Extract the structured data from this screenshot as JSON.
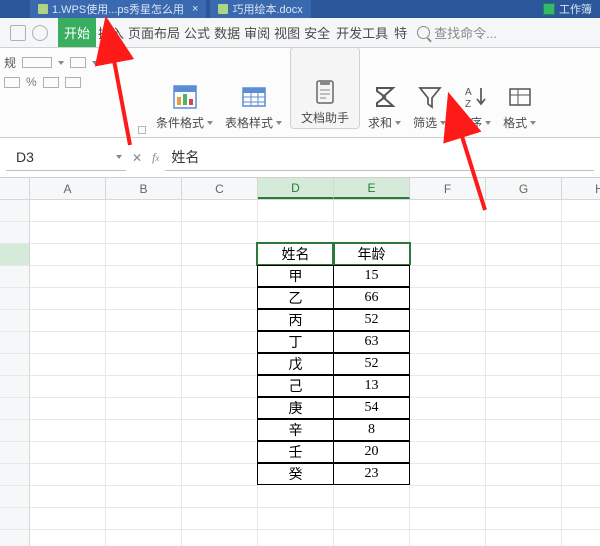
{
  "window": {
    "tab1_title": "1.WPS使用...ps秀星怎么用",
    "tab2_title": "巧用绘本.docx",
    "tab3_fragment": "工作簿"
  },
  "menu": {
    "start": "开始",
    "insert": "插入",
    "page_layout": "页面布局",
    "formulas": "公式",
    "data": "数据",
    "review": "审阅",
    "view": "视图",
    "security": "安全",
    "developer": "开发工具",
    "special": "特",
    "search_placeholder": "查找命令..."
  },
  "left_group_label": "规",
  "ribbon": {
    "cond_format": "条件格式",
    "table_style": "表格样式",
    "doc_helper": "文档助手",
    "sum": "求和",
    "filter": "筛选",
    "sort": "排序",
    "format": "格式"
  },
  "namebox": {
    "value": "D3"
  },
  "formula": {
    "value": "姓名"
  },
  "columns": [
    "A",
    "B",
    "C",
    "D",
    "E",
    "F",
    "G",
    "H"
  ],
  "selected_columns": [
    "D",
    "E"
  ],
  "table": {
    "header": {
      "name": "姓名",
      "age": "年龄"
    },
    "rows": [
      {
        "name": "甲",
        "age": 15
      },
      {
        "name": "乙",
        "age": 66
      },
      {
        "name": "丙",
        "age": 52
      },
      {
        "name": "丁",
        "age": 63
      },
      {
        "name": "戊",
        "age": 52
      },
      {
        "name": "己",
        "age": 13
      },
      {
        "name": "庚",
        "age": 54
      },
      {
        "name": "辛",
        "age": 8
      },
      {
        "name": "壬",
        "age": 20
      },
      {
        "name": "癸",
        "age": 23
      }
    ]
  },
  "annotations": [
    "arrow-to-start-tab",
    "arrow-to-filter-button"
  ]
}
